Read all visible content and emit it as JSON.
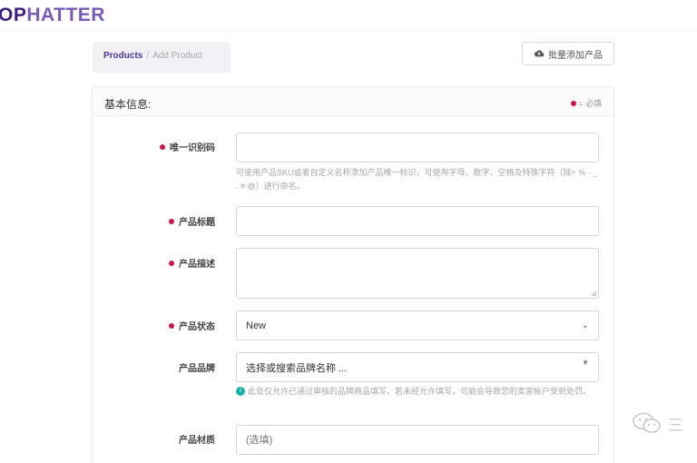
{
  "header": {
    "logo_part1": "OP",
    "logo_part2": "HATTER"
  },
  "breadcrumb": {
    "root": "Products",
    "separator": "/",
    "current": "Add Product"
  },
  "toolbar": {
    "bulk_add_label": "批量添加产品",
    "bulk_add_icon": "cloud-upload-icon"
  },
  "section": {
    "title": "基本信息:",
    "required_note": "= 必填"
  },
  "form": {
    "sku": {
      "label": "唯一识别码",
      "value": "",
      "help": "可使用产品SKU或者自定义名称添加产品唯一标识，可使用字母、数字、空格及特殊字符（除+ % - _ . # @）进行命名。"
    },
    "title": {
      "label": "产品标题",
      "value": ""
    },
    "description": {
      "label": "产品描述",
      "value": ""
    },
    "status": {
      "label": "产品状态",
      "value": "New"
    },
    "brand": {
      "label": "产品品牌",
      "placeholder": "选择或搜索品牌名称 ...",
      "help": "此处仅允许已通过审核的品牌商品填写。若未经允许填写，可能会导致您的卖家帐户受到处罚。"
    },
    "material": {
      "label": "产品材质",
      "placeholder": "(选填)"
    }
  },
  "colors": {
    "brand": "#3f1d82",
    "accent": "#4b3596",
    "required": "#d0124f",
    "info": "#1bb0a5"
  },
  "watermark": {
    "text": "三",
    "icon": "wechat-icon"
  }
}
